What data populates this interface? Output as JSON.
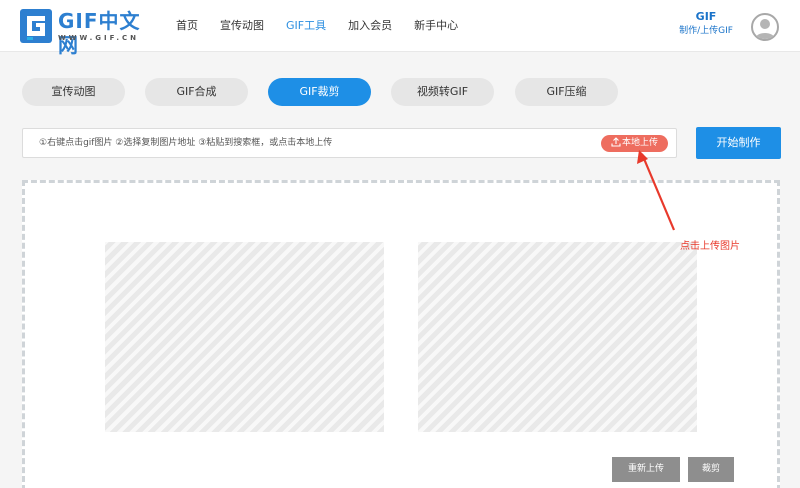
{
  "header": {
    "logo_text": "GIF中文网",
    "logo_sub": "WWW.GIF.CN",
    "nav": [
      {
        "label": "首页",
        "active": false
      },
      {
        "label": "宣传动图",
        "active": false
      },
      {
        "label": "GIF工具",
        "active": true
      },
      {
        "label": "加入会员",
        "active": false
      },
      {
        "label": "新手中心",
        "active": false
      }
    ],
    "right_title": "GIF",
    "right_link": "制作/上传GIF"
  },
  "tabs": [
    {
      "label": "宣传动图",
      "active": false
    },
    {
      "label": "GIF合成",
      "active": false
    },
    {
      "label": "GIF裁剪",
      "active": true
    },
    {
      "label": "视频转GIF",
      "active": false
    },
    {
      "label": "GIF压缩",
      "active": false
    }
  ],
  "toolbar": {
    "input_placeholder": "①右键点击gif图片 ②选择复制图片地址 ③粘贴到搜索框，或点击本地上传",
    "upload_label": "本地上传",
    "start_label": "开始制作"
  },
  "annotation": {
    "text": "点击上传图片",
    "color": "#e8392b"
  },
  "dropzone": {
    "reupload_label": "重新上传",
    "crop_label": "裁剪"
  },
  "colors": {
    "accent": "#1e8fe6",
    "upload": "#ee6d5f",
    "action_button": "#8e8e8e"
  }
}
